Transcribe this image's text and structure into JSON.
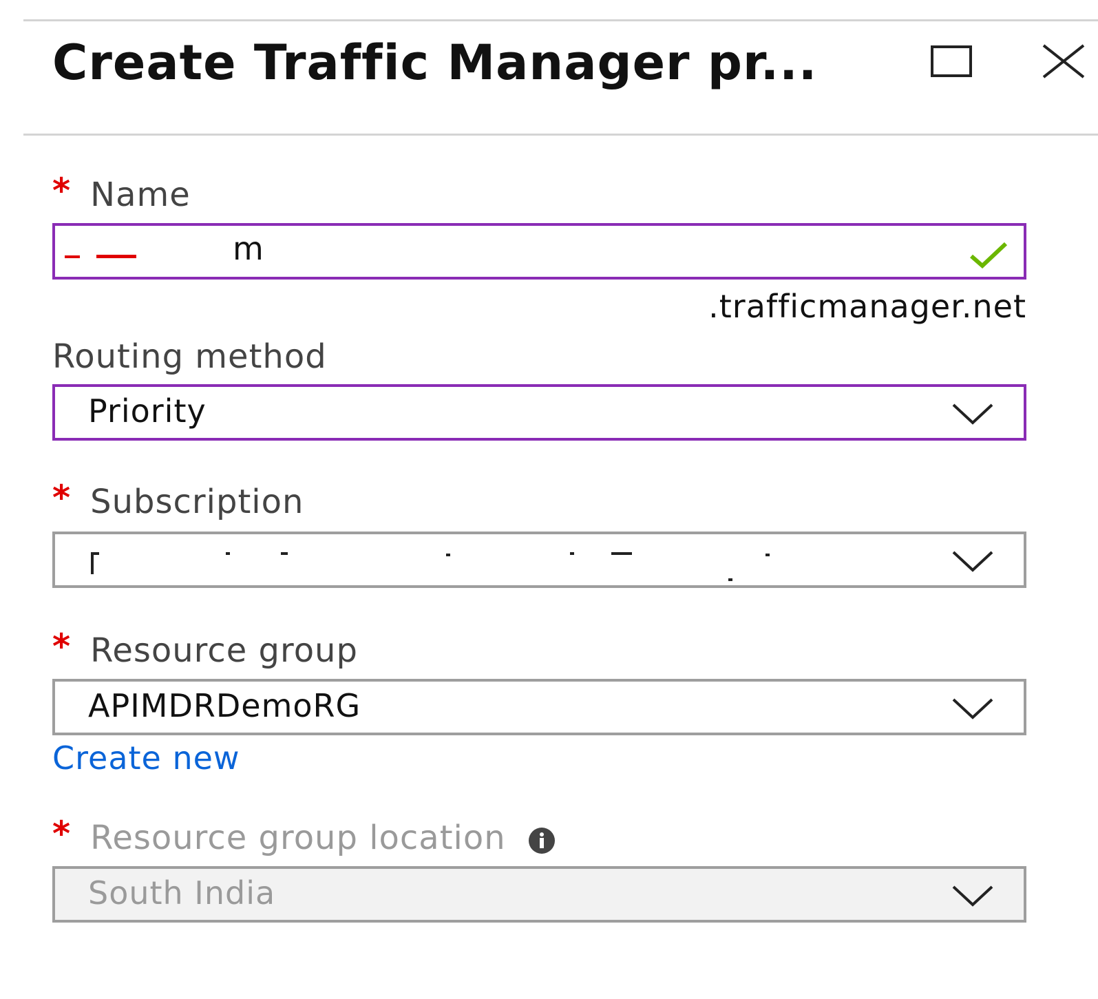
{
  "blade": {
    "title": "Create Traffic Manager pr...",
    "maximize_icon": "maximize-icon",
    "close_icon": "close-icon"
  },
  "form": {
    "name": {
      "label": "Name",
      "required_marker": "*",
      "value": "m",
      "valid_icon": "checkmark-icon",
      "suffix": ".trafficmanager.net"
    },
    "routing_method": {
      "label": "Routing method",
      "value": "Priority"
    },
    "subscription": {
      "label": "Subscription",
      "required_marker": "*",
      "value": ""
    },
    "resource_group": {
      "label": "Resource group",
      "required_marker": "*",
      "value": "APIMDRDemoRG",
      "create_new_link": "Create new"
    },
    "resource_group_location": {
      "label": "Resource group location",
      "required_marker": "*",
      "value": "South India",
      "info_icon": "info-icon"
    }
  },
  "colors": {
    "focus_border": "#8a2cb5",
    "required_star": "#e00000",
    "link": "#0a64d8",
    "valid_check": "#6bb700"
  }
}
